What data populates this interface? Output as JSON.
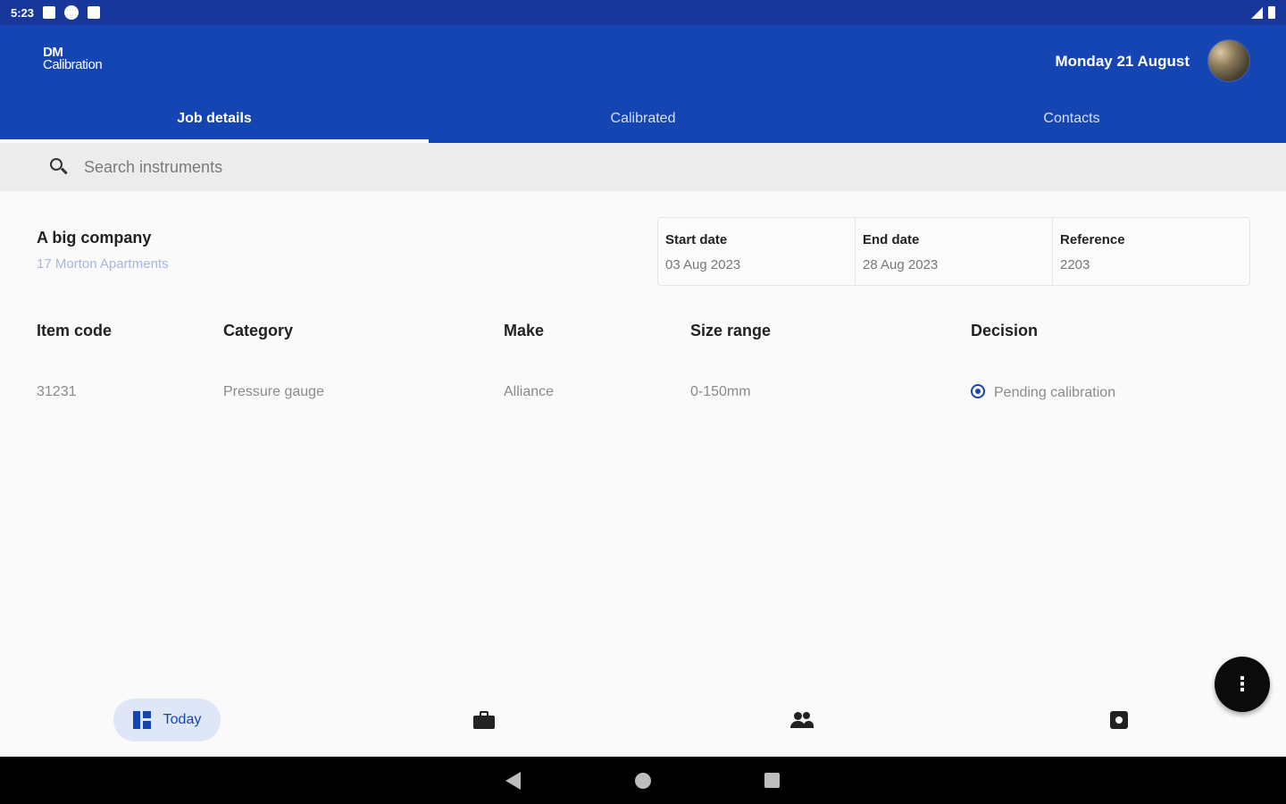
{
  "status_bar": {
    "time": "5:23"
  },
  "app": {
    "logo_line1": "DM",
    "logo_line2": "Calibration",
    "date": "Monday 21 August"
  },
  "tabs": [
    {
      "label": "Job details",
      "active": true
    },
    {
      "label": "Calibrated",
      "active": false
    },
    {
      "label": "Contacts",
      "active": false
    }
  ],
  "search": {
    "placeholder": "Search instruments",
    "value": ""
  },
  "company": {
    "name": "A big company",
    "address": "17 Morton Apartments"
  },
  "info": [
    {
      "label": "Start date",
      "value": "03 Aug 2023"
    },
    {
      "label": "End date",
      "value": "28 Aug 2023"
    },
    {
      "label": "Reference",
      "value": "2203"
    }
  ],
  "table": {
    "headers": [
      "Item code",
      "Category",
      "Make",
      "Size range",
      "Decision"
    ],
    "rows": [
      {
        "item_code": "31231",
        "category": "Pressure gauge",
        "make": "Alliance",
        "size_range": "0-150mm",
        "decision": "Pending calibration"
      }
    ]
  },
  "fab": {
    "icon": "more-vert-icon"
  },
  "bottom_nav": {
    "items": [
      {
        "label": "Today",
        "icon": "dashboard-icon",
        "active": true
      },
      {
        "label": "",
        "icon": "briefcase-icon",
        "active": false
      },
      {
        "label": "",
        "icon": "people-icon",
        "active": false
      },
      {
        "label": "",
        "icon": "settings-icon",
        "active": false
      }
    ]
  },
  "colors": {
    "primary": "#1545b3",
    "status_bar": "#17389a",
    "accent_link": "#a9b5e4"
  }
}
